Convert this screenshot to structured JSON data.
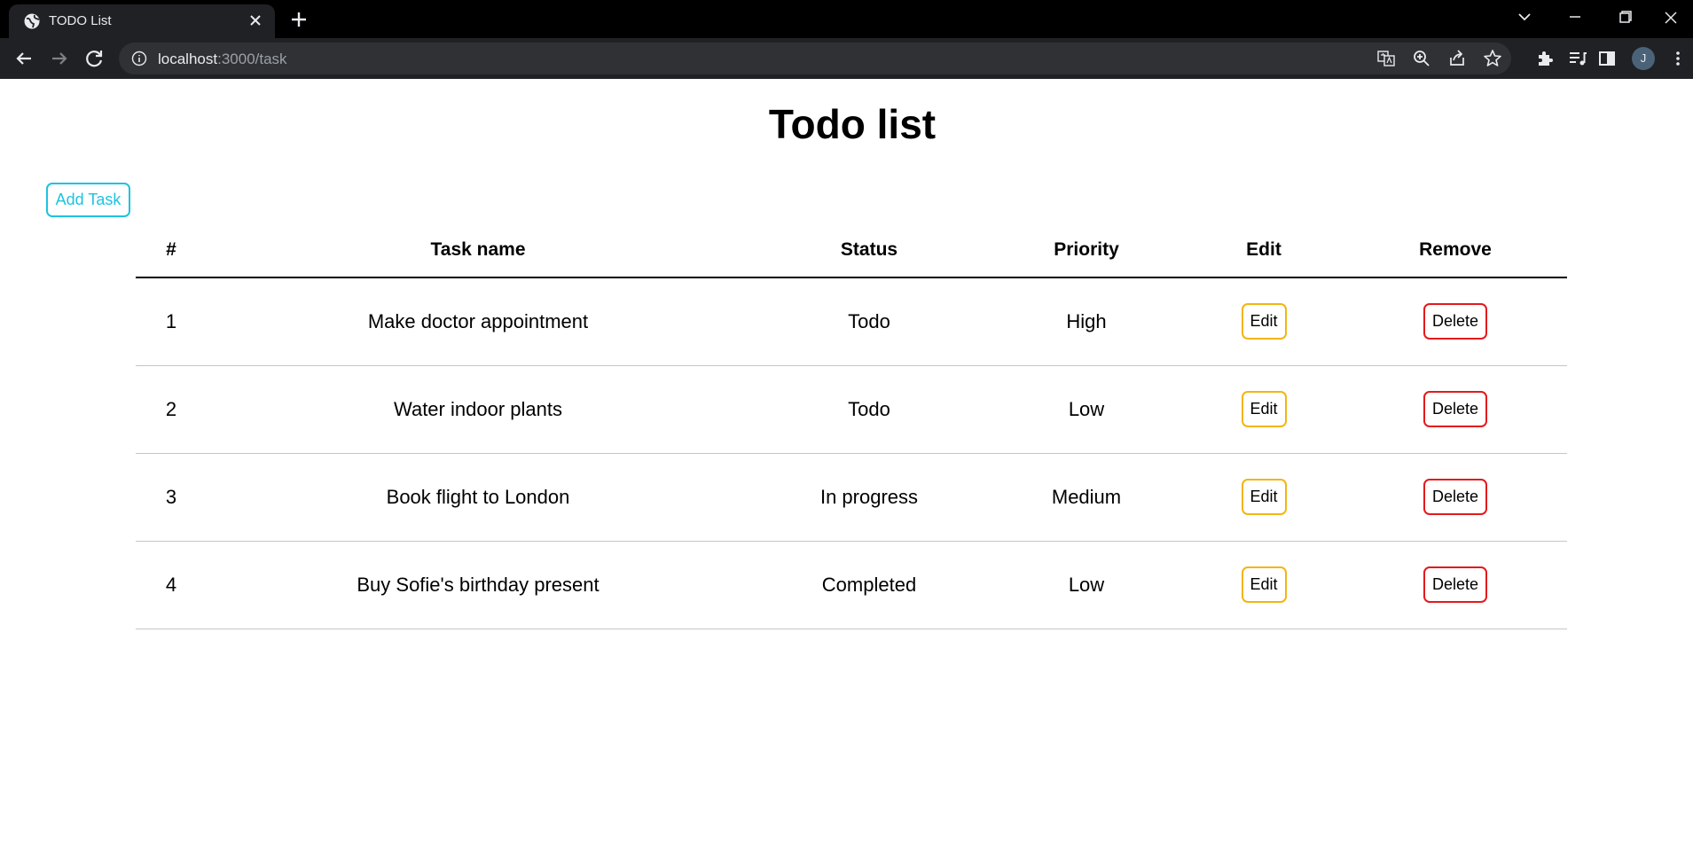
{
  "browser": {
    "tab_title": "TODO List",
    "url_host": "localhost",
    "url_path": ":3000/task",
    "profile_initial": "J"
  },
  "page": {
    "title": "Todo list",
    "add_task_label": "Add Task"
  },
  "table": {
    "headers": [
      "#",
      "Task name",
      "Status",
      "Priority",
      "Edit",
      "Remove"
    ],
    "rows": [
      {
        "num": "1",
        "name": "Make doctor appointment",
        "status": "Todo",
        "priority": "High",
        "edit": "Edit",
        "delete": "Delete"
      },
      {
        "num": "2",
        "name": "Water indoor plants",
        "status": "Todo",
        "priority": "Low",
        "edit": "Edit",
        "delete": "Delete"
      },
      {
        "num": "3",
        "name": "Book flight to London",
        "status": "In progress",
        "priority": "Medium",
        "edit": "Edit",
        "delete": "Delete"
      },
      {
        "num": "4",
        "name": "Buy Sofie's birthday present",
        "status": "Completed",
        "priority": "Low",
        "edit": "Edit",
        "delete": "Delete"
      }
    ]
  },
  "colors": {
    "add_button": "#1ec3e0",
    "edit_button": "#f3b512",
    "delete_button": "#e31a1c"
  }
}
